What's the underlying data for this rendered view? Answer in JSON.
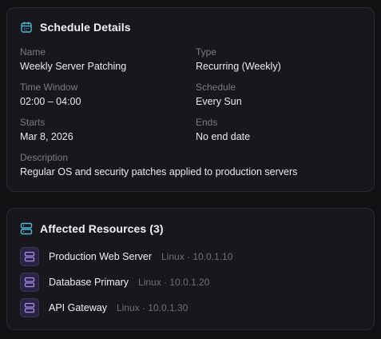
{
  "schedule": {
    "title": "Schedule Details",
    "icon": "calendar-icon",
    "accent": "#4fb8d6",
    "fields": [
      {
        "label": "Name",
        "value": "Weekly Server Patching"
      },
      {
        "label": "Type",
        "value": "Recurring (Weekly)"
      },
      {
        "label": "Time Window",
        "value": "02:00 – 04:00"
      },
      {
        "label": "Schedule",
        "value": "Every Sun"
      },
      {
        "label": "Starts",
        "value": "Mar 8, 2026"
      },
      {
        "label": "Ends",
        "value": "No end date"
      },
      {
        "label": "Description",
        "value": "Regular OS and security patches applied to production servers"
      }
    ]
  },
  "resources": {
    "title": "Affected Resources (3)",
    "icon": "server-icon",
    "items": [
      {
        "name": "Production Web Server",
        "meta": "Linux · 10.0.1.10"
      },
      {
        "name": "Database Primary",
        "meta": "Linux · 10.0.1.20"
      },
      {
        "name": "API Gateway",
        "meta": "Linux · 10.0.1.30"
      }
    ]
  }
}
